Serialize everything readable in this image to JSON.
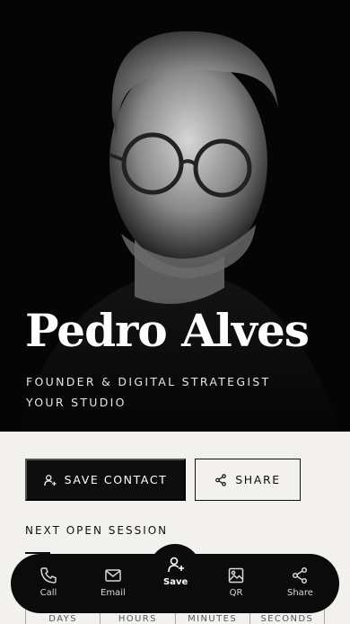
{
  "profile": {
    "name": "Pedro Alves",
    "role": "FOUNDER & DIGITAL STRATEGIST",
    "company": "YOUR STUDIO"
  },
  "actions": {
    "save_label": "SAVE CONTACT",
    "share_label": "SHARE"
  },
  "session": {
    "label": "NEXT OPEN SESSION",
    "units": [
      "DAYS",
      "HOURS",
      "MINUTES",
      "SECONDS"
    ]
  },
  "dock": {
    "items": [
      {
        "label": "Call",
        "icon": "phone-icon"
      },
      {
        "label": "Email",
        "icon": "mail-icon"
      },
      {
        "label": "Save",
        "icon": "user-plus-icon"
      },
      {
        "label": "QR",
        "icon": "image-icon"
      },
      {
        "label": "Share",
        "icon": "share-icon"
      }
    ]
  },
  "colors": {
    "hero_bg": "#050505",
    "page_bg": "#f3f1ed",
    "primary": "#0e0e0e",
    "text_light": "#ffffff"
  }
}
